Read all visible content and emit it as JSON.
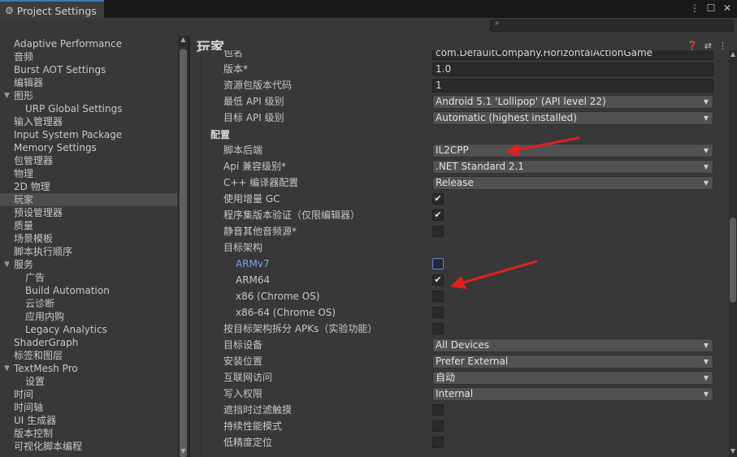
{
  "window": {
    "tab_title": "Project Settings",
    "icons": [
      "more-icon",
      "maximize-icon",
      "close-icon"
    ]
  },
  "search": {
    "placeholder": ""
  },
  "sidebar": {
    "items": [
      {
        "label": "Adaptive Performance",
        "indent": 0
      },
      {
        "label": "音频",
        "indent": 0
      },
      {
        "label": "Burst AOT Settings",
        "indent": 0
      },
      {
        "label": "编辑器",
        "indent": 0
      },
      {
        "label": "图形",
        "indent": 0,
        "expanded": true
      },
      {
        "label": "URP Global Settings",
        "indent": 1
      },
      {
        "label": "输入管理器",
        "indent": 0
      },
      {
        "label": "Input System Package",
        "indent": 0
      },
      {
        "label": "Memory Settings",
        "indent": 0
      },
      {
        "label": "包管理器",
        "indent": 0
      },
      {
        "label": "物理",
        "indent": 0
      },
      {
        "label": "2D 物理",
        "indent": 0
      },
      {
        "label": "玩家",
        "indent": 0,
        "selected": true
      },
      {
        "label": "预设管理器",
        "indent": 0
      },
      {
        "label": "质量",
        "indent": 0
      },
      {
        "label": "场景模板",
        "indent": 0
      },
      {
        "label": "脚本执行顺序",
        "indent": 0
      },
      {
        "label": "服务",
        "indent": 0,
        "expanded": true
      },
      {
        "label": "广告",
        "indent": 1
      },
      {
        "label": "Build Automation",
        "indent": 1
      },
      {
        "label": "云诊断",
        "indent": 1
      },
      {
        "label": "应用内购",
        "indent": 1
      },
      {
        "label": "Legacy Analytics",
        "indent": 1
      },
      {
        "label": "ShaderGraph",
        "indent": 0
      },
      {
        "label": "标签和图层",
        "indent": 0
      },
      {
        "label": "TextMesh Pro",
        "indent": 0,
        "expanded": true
      },
      {
        "label": "设置",
        "indent": 1
      },
      {
        "label": "时间",
        "indent": 0
      },
      {
        "label": "时间轴",
        "indent": 0
      },
      {
        "label": "UI 生成器",
        "indent": 0
      },
      {
        "label": "版本控制",
        "indent": 0
      },
      {
        "label": "可视化脚本编程",
        "indent": 0
      }
    ]
  },
  "main": {
    "title": "玩家",
    "header_icons": [
      "help-icon",
      "preset-icon",
      "more-icon"
    ],
    "rows": [
      {
        "label": "包名",
        "type": "field",
        "value": "com.DefaultCompany.HorizontalActionGame"
      },
      {
        "label": "版本*",
        "type": "field",
        "value": "1.0"
      },
      {
        "label": "资源包版本代码",
        "type": "field",
        "value": "1"
      },
      {
        "label": "最低 API 级别",
        "type": "dropdown",
        "value": "Android 5.1 'Lollipop' (API level 22)"
      },
      {
        "label": "目标 API 级别",
        "type": "dropdown",
        "value": "Automatic (highest installed)"
      },
      {
        "label": "配置",
        "type": "section"
      },
      {
        "label": "脚本后端",
        "type": "dropdown",
        "value": "IL2CPP"
      },
      {
        "label": "Api 兼容级别*",
        "type": "dropdown",
        "value": ".NET Standard 2.1"
      },
      {
        "label": "C++ 编译器配置",
        "type": "dropdown",
        "value": "Release"
      },
      {
        "label": "使用增量 GC",
        "type": "check",
        "checked": true
      },
      {
        "label": "程序集版本验证（仅限编辑器）",
        "type": "check",
        "checked": true
      },
      {
        "label": "静音其他音频源*",
        "type": "check",
        "checked": false
      },
      {
        "label": "目标架构",
        "type": "label"
      },
      {
        "label": "ARMv7",
        "type": "check",
        "checked": false,
        "indent": true,
        "link": true,
        "focus": true
      },
      {
        "label": "ARM64",
        "type": "check",
        "checked": true,
        "indent": true
      },
      {
        "label": "x86 (Chrome OS)",
        "type": "check",
        "checked": false,
        "indent": true
      },
      {
        "label": "x86-64 (Chrome OS)",
        "type": "check",
        "checked": false,
        "indent": true
      },
      {
        "label": "按目标架构拆分 APKs（实验功能）",
        "type": "check",
        "checked": false
      },
      {
        "label": "目标设备",
        "type": "dropdown",
        "value": "All Devices"
      },
      {
        "label": "安装位置",
        "type": "dropdown",
        "value": "Prefer External"
      },
      {
        "label": "互联网访问",
        "type": "dropdown",
        "value": "自动"
      },
      {
        "label": "写入权限",
        "type": "dropdown",
        "value": "Internal"
      },
      {
        "label": "遮挡时过滤触摸",
        "type": "check",
        "checked": false
      },
      {
        "label": "持续性能模式",
        "type": "check",
        "checked": false
      },
      {
        "label": "低精度定位",
        "type": "check",
        "checked": false
      }
    ]
  },
  "colors": {
    "background": "#383838",
    "field_bg": "#2a2a2a",
    "dropdown_bg": "#515151",
    "accent_tab": "#3a79bb",
    "annotation_arrow": "#e02020"
  }
}
